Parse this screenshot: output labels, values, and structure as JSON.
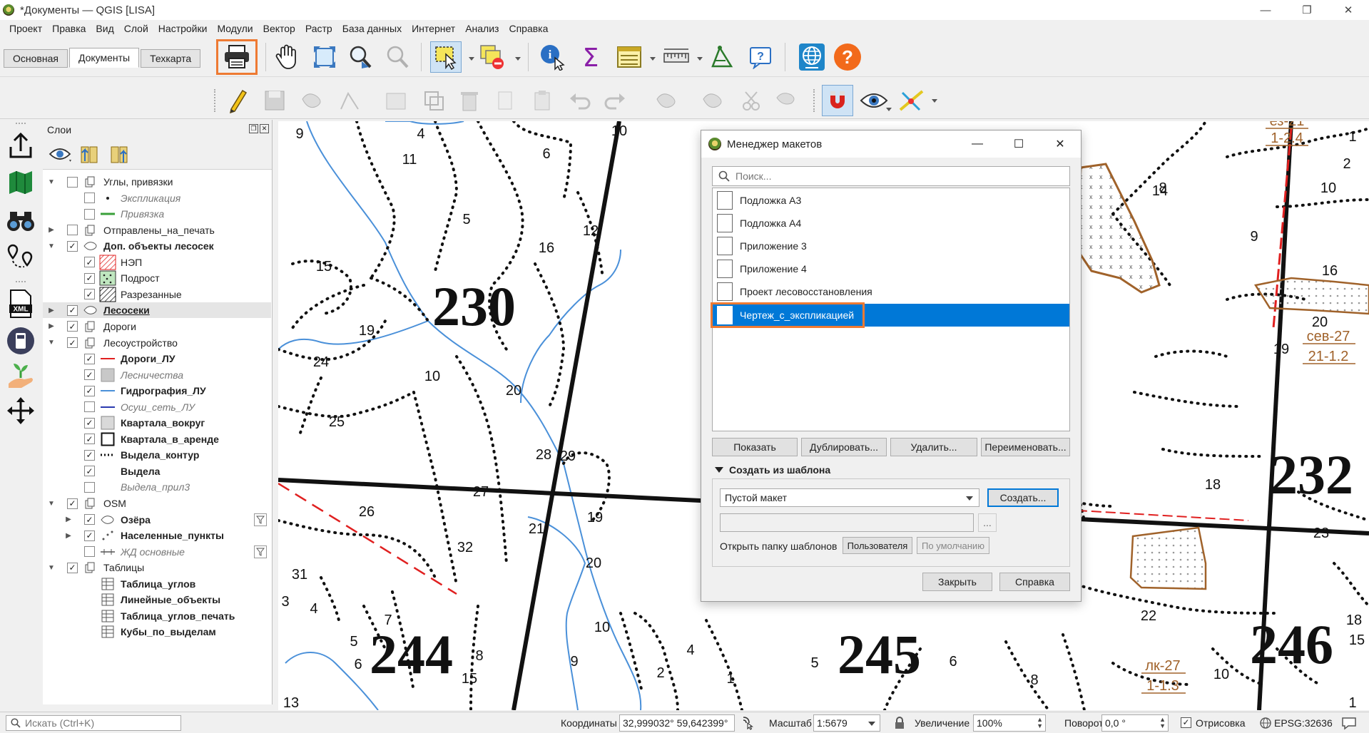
{
  "window": {
    "title": "*Документы — QGIS [LISA]",
    "min": "—",
    "max": "❐",
    "close": "✕"
  },
  "menu": [
    "Проект",
    "Правка",
    "Вид",
    "Слой",
    "Настройки",
    "Модули",
    "Вектор",
    "Растр",
    "База данных",
    "Интернет",
    "Анализ",
    "Справка"
  ],
  "tabs": [
    "Основная",
    "Документы",
    "Техкарта"
  ],
  "active_tab": "Документы",
  "toolbar_icons": [
    "print-layout-icon",
    "pan-icon",
    "zoom-full-icon",
    "zoom-layer-icon",
    "zoom-selection-icon",
    "select-features-icon",
    "deselect-icon",
    "identify-icon",
    "statistics-icon",
    "attribute-table-icon",
    "measure-icon",
    "vertex-tool-icon",
    "help-icon",
    "globe-icon",
    "question-icon"
  ],
  "layers_panel": {
    "title": "Слои",
    "tree": [
      {
        "label": "Углы, привязки",
        "checked": false,
        "expand": "▼",
        "kind": "group",
        "indent": 0
      },
      {
        "label": "Экспликация",
        "checked": false,
        "kind": "point",
        "indent": 1,
        "style": "italic"
      },
      {
        "label": "Привязка",
        "checked": false,
        "kind": "line-green",
        "indent": 1,
        "style": "italic"
      },
      {
        "label": "Отправлены_на_печать",
        "checked": false,
        "expand": "▶",
        "kind": "group",
        "indent": 0
      },
      {
        "label": "Доп. объекты лесосек",
        "checked": true,
        "expand": "▼",
        "kind": "polygon",
        "indent": 0,
        "style": "bold"
      },
      {
        "label": "НЭП",
        "checked": true,
        "kind": "hatch-red",
        "indent": 1
      },
      {
        "label": "Подрост",
        "checked": true,
        "kind": "dots-green",
        "indent": 1
      },
      {
        "label": "Разрезанные",
        "checked": true,
        "kind": "hatch-black",
        "indent": 1
      },
      {
        "label": "Лесосеки",
        "checked": true,
        "expand": "▶",
        "kind": "polygon",
        "indent": 0,
        "style": "bold-underline",
        "selected": true
      },
      {
        "label": "Дороги",
        "checked": true,
        "expand": "▶",
        "kind": "group",
        "indent": 0
      },
      {
        "label": "Лесоустройство",
        "checked": true,
        "expand": "▼",
        "kind": "group",
        "indent": 0
      },
      {
        "label": "Дороги_ЛУ",
        "checked": true,
        "kind": "line-red",
        "indent": 1,
        "style": "bold"
      },
      {
        "label": "Лесничества",
        "checked": true,
        "kind": "fill-gray",
        "indent": 1,
        "style": "italic"
      },
      {
        "label": "Гидрография_ЛУ",
        "checked": true,
        "kind": "line-blue",
        "indent": 1,
        "style": "bold"
      },
      {
        "label": "Осуш_сеть_ЛУ",
        "checked": false,
        "kind": "line-navy",
        "indent": 1,
        "style": "italic"
      },
      {
        "label": "Квартала_вокруг",
        "checked": true,
        "kind": "fill-lightgray",
        "indent": 1,
        "style": "bold"
      },
      {
        "label": "Квартала_в_аренде",
        "checked": true,
        "kind": "outline-black",
        "indent": 1,
        "style": "bold"
      },
      {
        "label": "Выдела_контур",
        "checked": true,
        "kind": "line-dots",
        "indent": 1,
        "style": "bold"
      },
      {
        "label": "Выдела",
        "checked": true,
        "kind": "none",
        "indent": 1,
        "style": "bold"
      },
      {
        "label": "Выдела_прил3",
        "checked": false,
        "kind": "none",
        "indent": 1,
        "style": "italic"
      },
      {
        "label": "OSM",
        "checked": true,
        "expand": "▼",
        "kind": "group",
        "indent": 0
      },
      {
        "label": "Озёра",
        "checked": true,
        "expand": "▶",
        "kind": "polygon",
        "indent": 1,
        "style": "bold",
        "filter": true
      },
      {
        "label": "Населенные_пункты",
        "checked": true,
        "expand": "▶",
        "kind": "points",
        "indent": 1,
        "style": "bold"
      },
      {
        "label": "ЖД основные",
        "checked": false,
        "kind": "rail",
        "indent": 1,
        "style": "italic",
        "filter": true
      },
      {
        "label": "Таблицы",
        "checked": true,
        "expand": "▼",
        "kind": "group",
        "indent": 0
      },
      {
        "label": "Таблица_углов",
        "kind": "table",
        "indent": 1,
        "style": "bold"
      },
      {
        "label": "Линейные_объекты",
        "kind": "table",
        "indent": 1,
        "style": "bold"
      },
      {
        "label": "Таблица_углов_печать",
        "kind": "table",
        "indent": 1,
        "style": "bold"
      },
      {
        "label": "Кубы_по_выделам",
        "kind": "table",
        "indent": 1,
        "style": "bold"
      }
    ]
  },
  "map": {
    "big_labels": [
      "230",
      "232",
      "244",
      "245",
      "246"
    ],
    "small_labels": [
      "9",
      "4",
      "11",
      "6",
      "10",
      "5",
      "12",
      "16",
      "15",
      "19",
      "24",
      "10",
      "20",
      "25",
      "28",
      "29",
      "27",
      "26",
      "21",
      "19",
      "32",
      "31",
      "20",
      "3",
      "4",
      "7",
      "5",
      "6",
      "8",
      "15",
      "9",
      "10",
      "4",
      "2",
      "1",
      "5",
      "6",
      "14",
      "16",
      "13",
      "8",
      "22",
      "10",
      "14",
      "18",
      "20",
      "23",
      "9",
      "16",
      "1",
      "2",
      "10",
      "8",
      "19",
      "18",
      "15",
      "1"
    ],
    "cut_labels": [
      {
        "top": "сев-27",
        "bottom": "21-1.2"
      },
      {
        "top": "лк-27",
        "bottom": "1-1.3"
      },
      {
        "top": "ез-21",
        "bottom": "1-2.4"
      }
    ]
  },
  "dialog": {
    "title": "Менеджер макетов",
    "search_placeholder": "Поиск...",
    "layouts": [
      "Подложка А3",
      "Подложка А4",
      "Приложение 3",
      "Приложение 4",
      "Проект лесовосстановления",
      "Чертеж_с_экспликацией"
    ],
    "selected_layout": "Чертеж_с_экспликацией",
    "buttons": {
      "show": "Показать",
      "duplicate": "Дублировать...",
      "delete": "Удалить...",
      "rename": "Переименовать..."
    },
    "template_group": {
      "title": "Создать из шаблона",
      "template_value": "Пустой макет",
      "create": "Создать...",
      "path_value": "",
      "browse": "...",
      "open_folder_label": "Открыть папку шаблонов",
      "user": "Пользователя",
      "default": "По умолчанию"
    },
    "close": "Закрыть",
    "help": "Справка"
  },
  "status": {
    "search_placeholder": "Искать (Ctrl+K)",
    "coord_label": "Координаты",
    "coord_value": "32,999032° 59,642399°",
    "scale_label": "Масштаб",
    "scale_value": "1:5679",
    "magnifier_label": "Увеличение",
    "magnifier_value": "100%",
    "rotation_label": "Поворот",
    "rotation_value": "0,0 °",
    "render_label": "Отрисовка",
    "render_checked": true,
    "crs": "EPSG:32636"
  },
  "colors": {
    "accent": "#0078d7",
    "highlight": "#ee7a33",
    "river": "#4a90d9",
    "road": "#e02020",
    "cut_border": "#a0622a"
  }
}
